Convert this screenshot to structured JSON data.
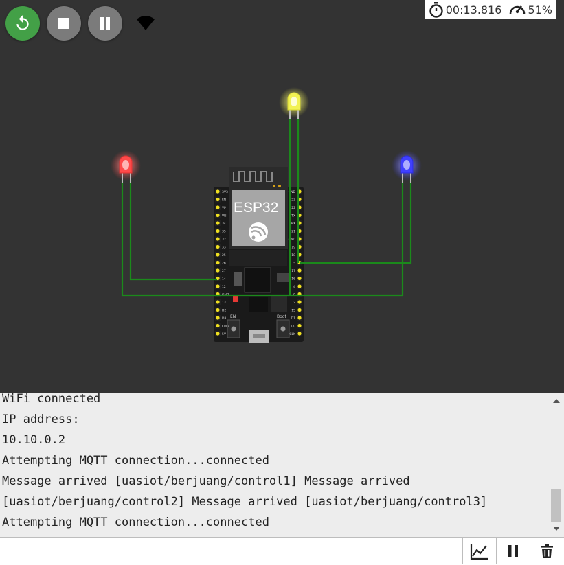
{
  "toolbar": {
    "restart_icon": "restart-icon",
    "stop_icon": "stop-icon",
    "pause_icon": "pause-icon",
    "wifi_icon": "wifi-icon",
    "colors": {
      "restart_bg": "#43a047",
      "control_bg": "#7b7b7b"
    }
  },
  "status": {
    "timer_icon": "stopwatch-icon",
    "elapsed": "00:13.816",
    "speed_icon": "speedometer-icon",
    "speed": "51%"
  },
  "board": {
    "chip_label": "ESP32",
    "left_pins": [
      "3V3",
      "EN",
      "VP",
      "VN",
      "34",
      "35",
      "32",
      "33",
      "25",
      "26",
      "27",
      "14",
      "12",
      "GND",
      "13",
      "D2",
      "D3",
      "CMD",
      "5V"
    ],
    "right_pins": [
      "GND",
      "23",
      "22",
      "TX",
      "RX",
      "21",
      "GND",
      "19",
      "18",
      "5",
      "17",
      "16",
      "4",
      "0",
      "2",
      "15",
      "D1",
      "D0",
      "CLK"
    ],
    "button_labels": {
      "en": "EN",
      "boot": "Boot"
    }
  },
  "leds": [
    {
      "name": "red",
      "color": "#ff3b3b",
      "glow": "#ff8080",
      "lit": true
    },
    {
      "name": "yellow",
      "color": "#f5f542",
      "glow": "#ffff99",
      "lit": true
    },
    {
      "name": "blue",
      "color": "#3a3aff",
      "glow": "#8080ff",
      "lit": true
    }
  ],
  "serial": {
    "lines": [
      "WiFi connected",
      "IP address:",
      "10.10.0.2",
      "Attempting MQTT connection...connected",
      "Message arrived [uasiot/berjuang/control1] Message arrived",
      "[uasiot/berjuang/control2] Message arrived [uasiot/berjuang/control3]",
      "Attempting MQTT connection...connected"
    ],
    "input_placeholder": ""
  },
  "bottom_bar": {
    "plotter_icon": "chart-line-icon",
    "pause_icon": "pause-icon",
    "clear_icon": "trash-icon"
  }
}
